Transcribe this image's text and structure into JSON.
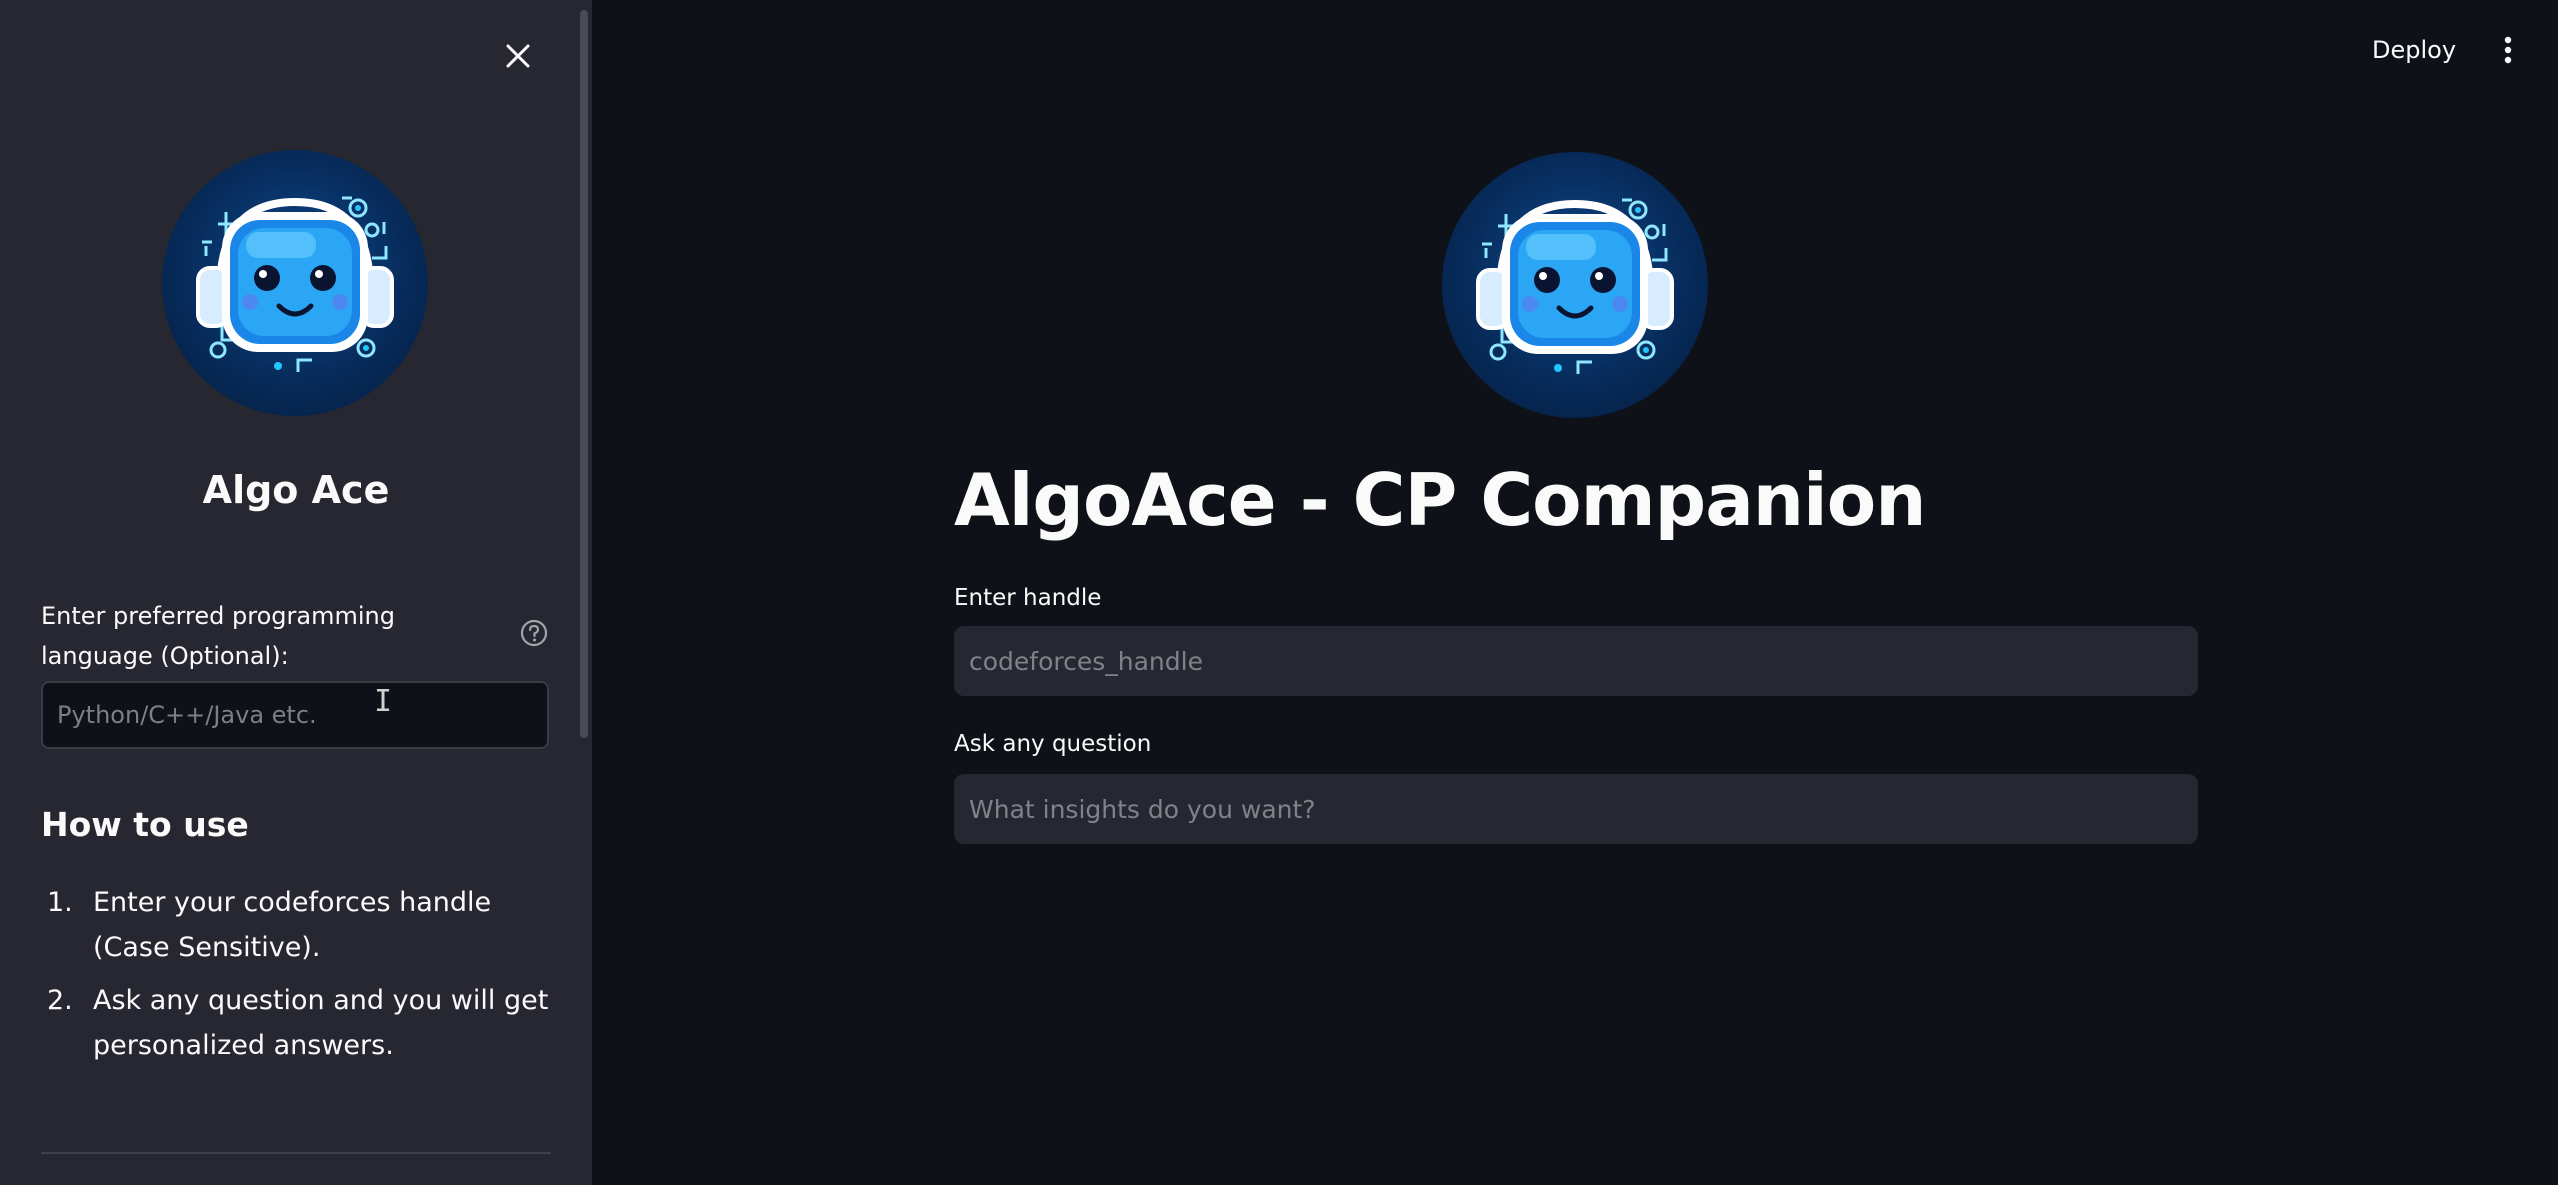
{
  "sidebar": {
    "title": "Algo Ace",
    "lang_label": "Enter preferred programming language (Optional):",
    "lang_placeholder": "Python/C++/Java etc.",
    "lang_value": "",
    "how_to_heading": "How to use",
    "steps": [
      {
        "num": "1.",
        "text": "Enter your codeforces handle (Case Sensitive)."
      },
      {
        "num": "2.",
        "text": "Ask any question and you will get personalized answers."
      }
    ]
  },
  "header": {
    "deploy_label": "Deploy"
  },
  "main": {
    "title": "AlgoAce - CP Companion",
    "handle_label": "Enter handle",
    "handle_placeholder": "codeforces_handle",
    "question_label": "Ask any question",
    "question_placeholder": "What insights do you want?"
  },
  "icons": {
    "close": "close-icon",
    "help": "help-circle-icon",
    "menu": "kebab-menu-icon",
    "logo": "robot-logo-icon",
    "cursor": "text-cursor-icon"
  },
  "colors": {
    "sidebar_bg": "#262730",
    "main_bg": "#0e1117",
    "input_bg": "#262730",
    "text": "#fafafa",
    "logo_accent": "#22a7f0"
  }
}
